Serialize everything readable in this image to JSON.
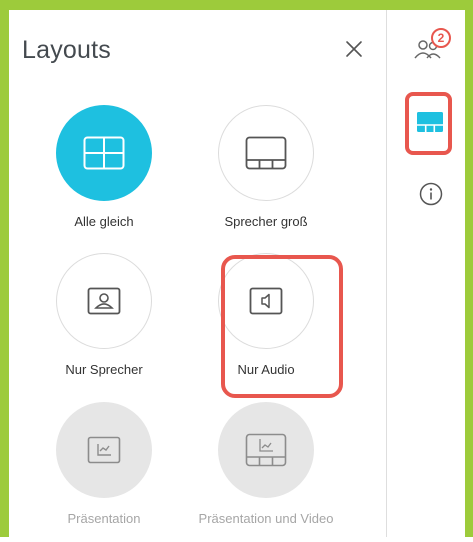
{
  "panel": {
    "title": "Layouts",
    "close_icon": "close-icon"
  },
  "layouts": [
    {
      "label": "Alle gleich",
      "icon": "grid-layout-icon",
      "state": "selected"
    },
    {
      "label": "Sprecher groß",
      "icon": "speaker-large-layout-icon",
      "state": "normal"
    },
    {
      "label": "Nur Sprecher",
      "icon": "speaker-only-icon",
      "state": "normal"
    },
    {
      "label": "Nur Audio",
      "icon": "audio-only-icon",
      "state": "normal"
    },
    {
      "label": "Präsentation",
      "icon": "presentation-icon",
      "state": "disabled"
    },
    {
      "label": "Präsentation und Video",
      "icon": "presentation-video-icon",
      "state": "disabled"
    }
  ],
  "sidebar": {
    "participants_badge": "2",
    "participants_icon": "participants-icon",
    "layout_icon": "layout-icon",
    "info_icon": "info-icon"
  },
  "colors": {
    "frame": "#9dcb3b",
    "accent": "#1ec0e0",
    "highlight": "#e8574e",
    "disabled": "#e6e6e6"
  }
}
